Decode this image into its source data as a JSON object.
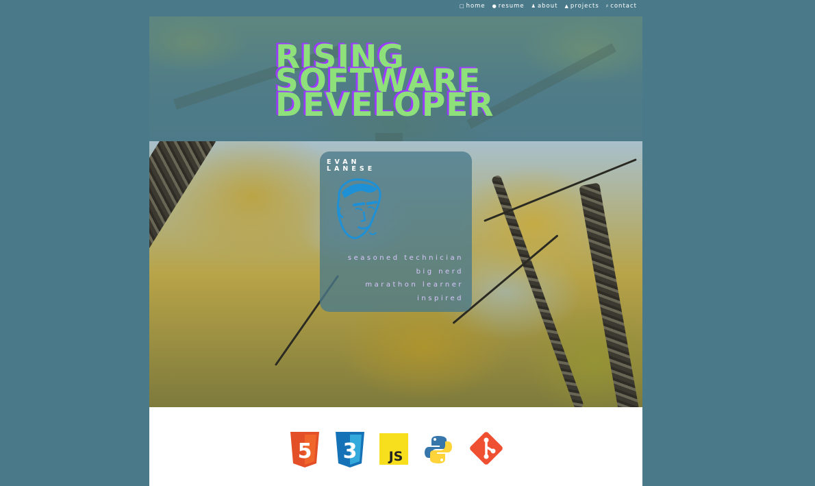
{
  "nav": {
    "items": [
      {
        "label": "home",
        "icon": "chat-icon"
      },
      {
        "label": "resume",
        "icon": "document-icon"
      },
      {
        "label": "about",
        "icon": "person-icon"
      },
      {
        "label": "projects",
        "icon": "folder-icon"
      },
      {
        "label": "contact",
        "icon": "mail-icon"
      }
    ]
  },
  "hero": {
    "headline": [
      "RISING",
      "SOFTWARE",
      "DEVELOPER"
    ]
  },
  "profile": {
    "first_name": "EVAN",
    "last_name": "LANESE",
    "traits": [
      "seasoned technician",
      "big nerd",
      "marathon learner",
      "inspired"
    ]
  },
  "skills": {
    "icons": [
      "html5-icon",
      "css3-icon",
      "javascript-icon",
      "python-icon",
      "git-icon"
    ],
    "labels": {
      "html": "5",
      "css": "3",
      "js": "JS"
    }
  },
  "colors": {
    "page_background": "#4a7a8a",
    "headline": "#8ee07a",
    "headline_shadow": "#9a3cff",
    "traits": "#d9c8ff",
    "avatar": "#1e90d6"
  }
}
